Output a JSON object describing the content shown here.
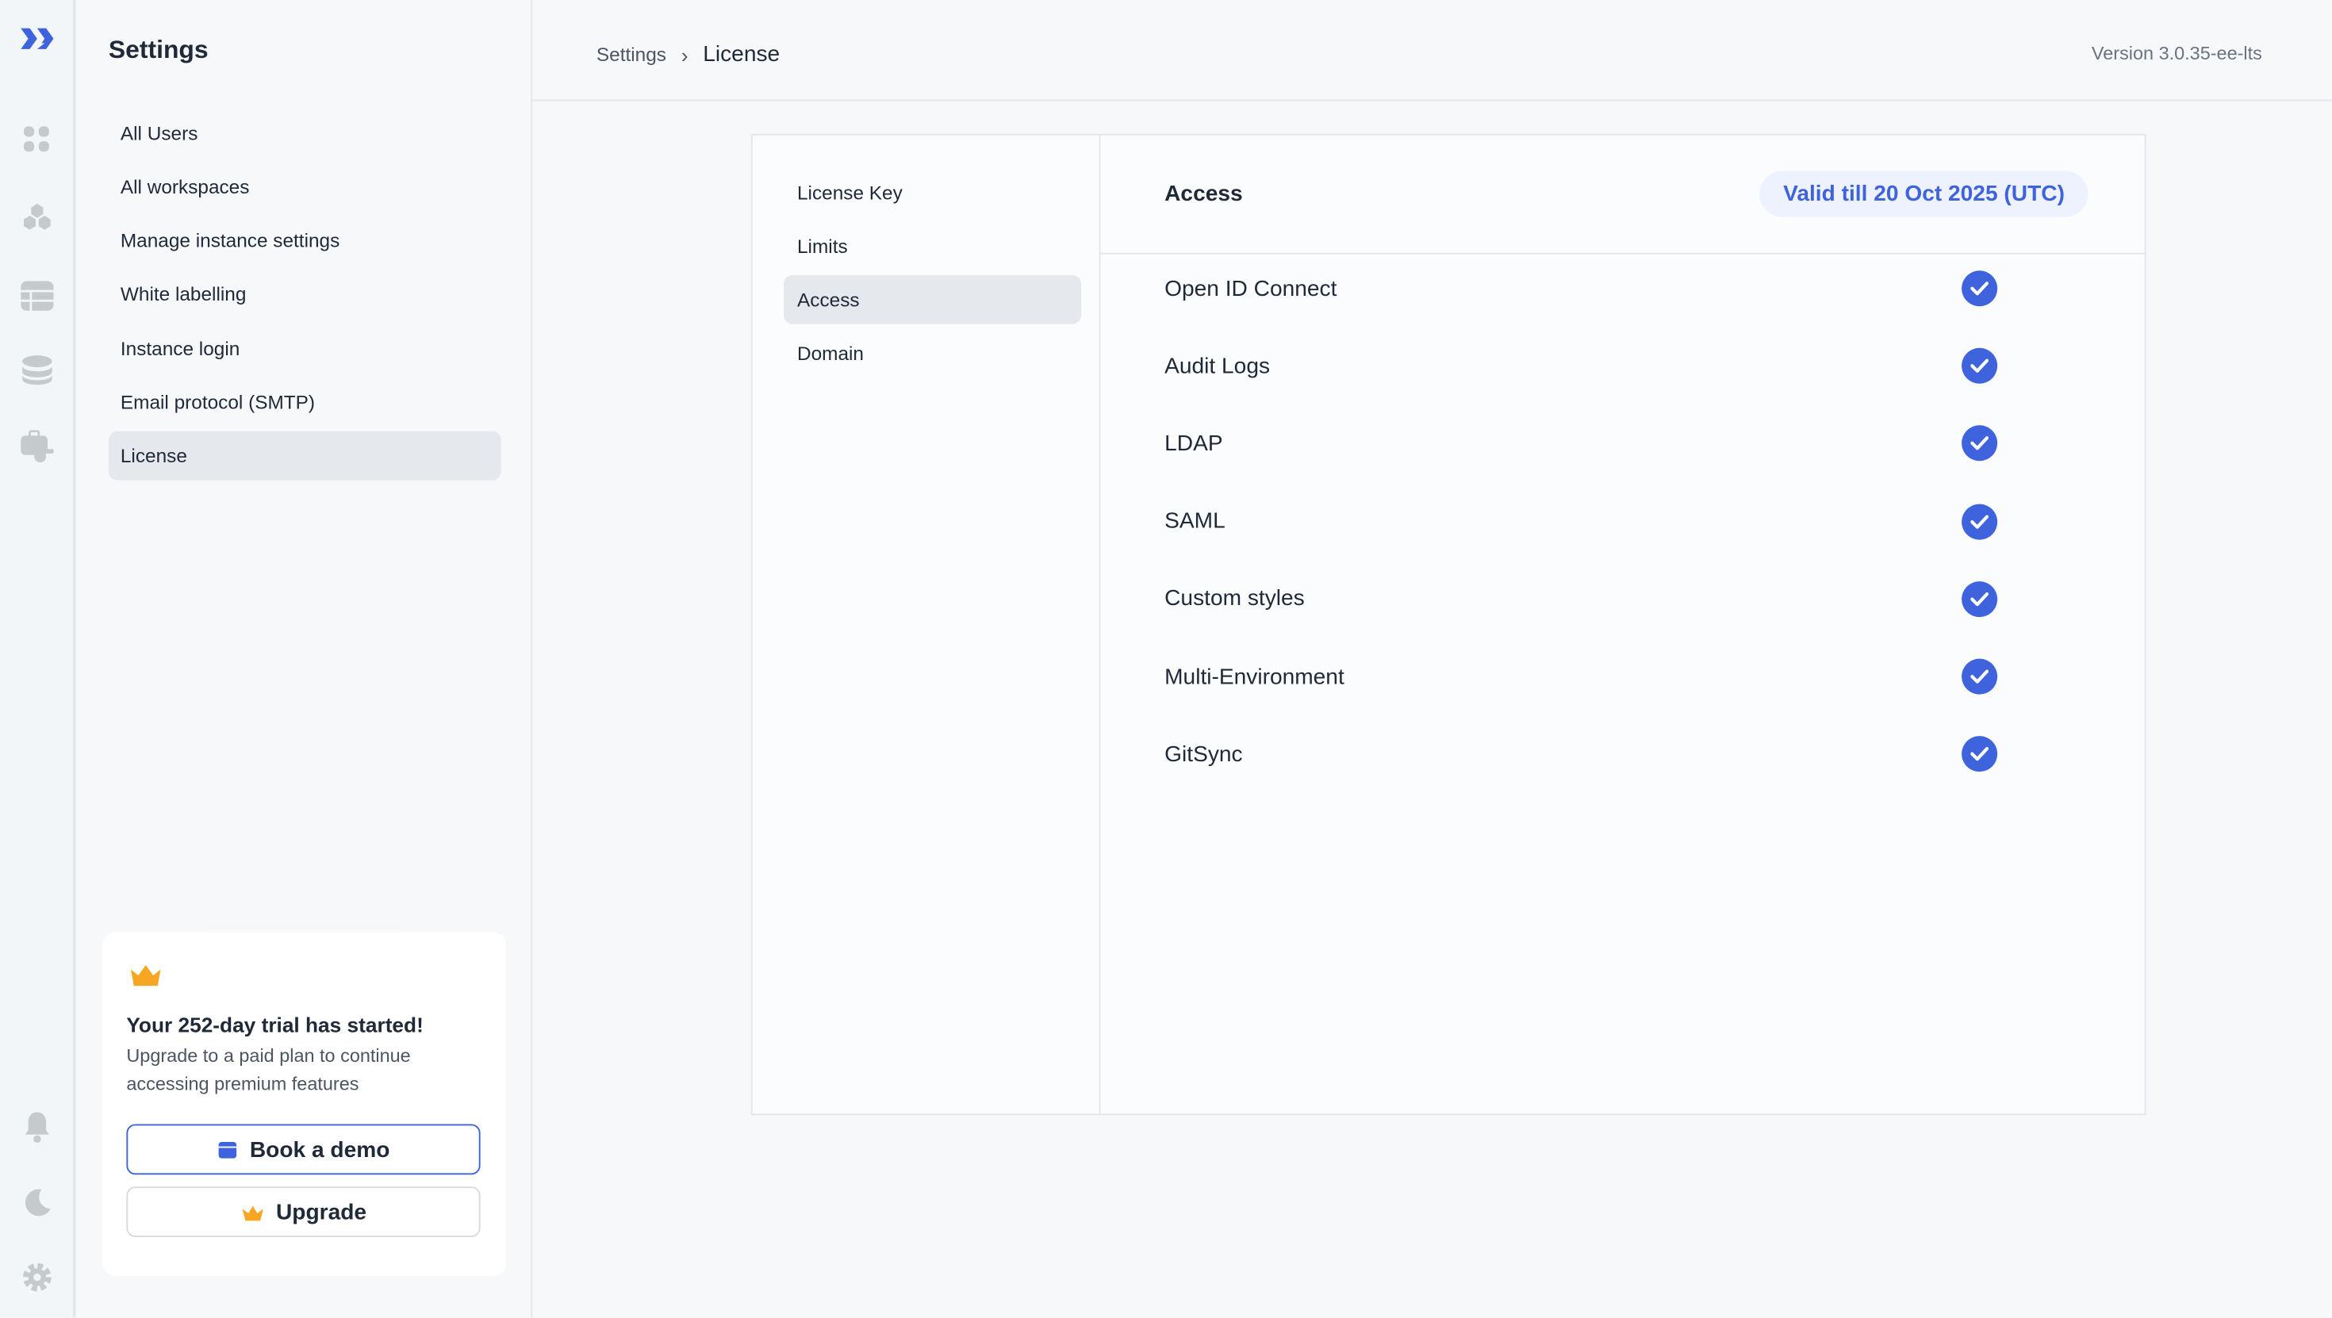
{
  "colors": {
    "accent": "#3e63dd",
    "badge_bg": "#edf2fe",
    "crown": "#f5a623"
  },
  "rail": {
    "icons": [
      "logo-icon",
      "apps-icon",
      "workflows-icon",
      "tables-icon",
      "database-icon",
      "workspace-constants-icon",
      "bell-icon",
      "moon-icon",
      "gear-icon"
    ]
  },
  "sidebar": {
    "title": "Settings",
    "items": [
      {
        "label": "All Users"
      },
      {
        "label": "All workspaces"
      },
      {
        "label": "Manage instance settings"
      },
      {
        "label": "White labelling"
      },
      {
        "label": "Instance login"
      },
      {
        "label": "Email protocol (SMTP)"
      },
      {
        "label": "License",
        "active": true
      }
    ]
  },
  "trial": {
    "title": "Your 252-day trial has started!",
    "body": "Upgrade to a paid plan to continue accessing premium features",
    "book_demo": "Book a demo",
    "upgrade": "Upgrade"
  },
  "header": {
    "breadcrumb": [
      "Settings",
      "License"
    ],
    "version": "Version 3.0.35-ee-lts"
  },
  "license": {
    "tabs": [
      {
        "label": "License Key"
      },
      {
        "label": "Limits"
      },
      {
        "label": "Access",
        "active": true
      },
      {
        "label": "Domain"
      }
    ],
    "title": "Access",
    "validity": "Valid till 20 Oct 2025 (UTC)",
    "features": [
      {
        "label": "Open ID Connect",
        "enabled": true
      },
      {
        "label": "Audit Logs",
        "enabled": true
      },
      {
        "label": "LDAP",
        "enabled": true
      },
      {
        "label": "SAML",
        "enabled": true
      },
      {
        "label": "Custom styles",
        "enabled": true
      },
      {
        "label": "Multi-Environment",
        "enabled": true
      },
      {
        "label": "GitSync",
        "enabled": true
      }
    ]
  }
}
